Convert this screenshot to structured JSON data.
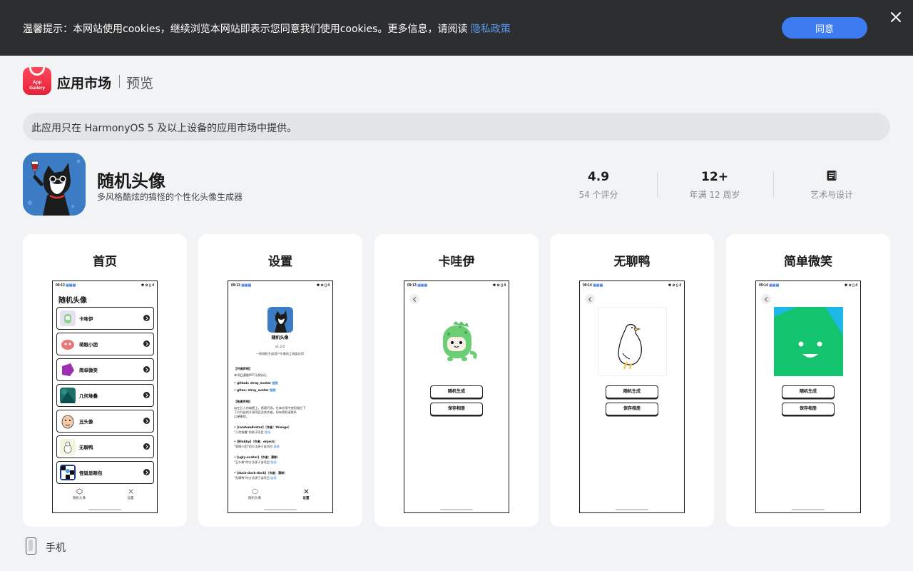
{
  "cookie_banner": {
    "text": "温馨提示：本网站使用cookies，继续浏览本网站即表示您同意我们使用cookies。更多信息，请阅读",
    "link": "隐私政策",
    "agree_label": "同意"
  },
  "header": {
    "logo_text_1": "App",
    "logo_text_2": "Gallery",
    "brand": "应用市场",
    "sub": "预览"
  },
  "notice": "此应用只在 HarmonyOS 5 及以上设备的应用市场中提供。",
  "app": {
    "name": "随机头像",
    "description": "多风格酷炫的搞怪的个性化头像生成器"
  },
  "stats": [
    {
      "value": "4.9",
      "label": "54 个评分"
    },
    {
      "value": "12+",
      "label": "年满 12 周岁"
    },
    {
      "value": "",
      "label": "艺术与设计",
      "icon": "book-icon"
    }
  ],
  "screenshots": [
    {
      "title": "首页"
    },
    {
      "title": "设置"
    },
    {
      "title": "卡哇伊"
    },
    {
      "title": "无聊鸭"
    },
    {
      "title": "简单微笑"
    }
  ],
  "phone": {
    "time_1": "09:13",
    "time_2": "09:14",
    "status_right": "✱ ⊘ ▯ 4",
    "home_title": "随机头像",
    "home_items": [
      "卡哇伊",
      "萌眼小团",
      "简单微笑",
      "几何堆叠",
      "丑头像",
      "无聊鸭",
      "怪诞显眼包"
    ],
    "tab_home": "随机头像",
    "tab_settings": "设置",
    "generate": "随机生成",
    "save": "保存相册",
    "settings": {
      "app_name": "随机头像",
      "version": "v1.2.0",
      "tagline": "一款随机生成用户头像的工具类应用",
      "open_title": "【开源声明】",
      "open_desc": "本项目遵循MIT开源协议。",
      "github": "• github: stray_avatar",
      "gitee": "• gitee: stray_avatar",
      "link": "链接",
      "thanks_title": "【致谢声明】",
      "thanks_desc_1": "站在巨人的肩膀上，感谢开源。在本应用中使用相应下",
      "thanks_desc_2": "下方列出的开源项目及其作者。如有侵权请联系",
      "thanks_desc_3": "以便删除。",
      "c1": "• [randomAvatar]（作者：thisago）",
      "c1d": "\"几何堆叠\"的原子项目",
      "c2": "• [Blobby]（作者：enjeck）",
      "c2d": "\"萌眼小团\"的方法源于该项目",
      "c3": "• [ugly-avatar]（作者：漂移）",
      "c3d": "\"丑头像\"的方法源于该项目",
      "c4": "• [duck-duck-duck]（作者：漂移）",
      "c4d": "\"无聊鸭\"的方法源于该项目"
    }
  },
  "device": "手机",
  "colors": {
    "accent": "#3d7bf0",
    "banner_bg": "#2d2e30",
    "link": "#5b9cf2",
    "page_bg": "#f1f3f5"
  }
}
